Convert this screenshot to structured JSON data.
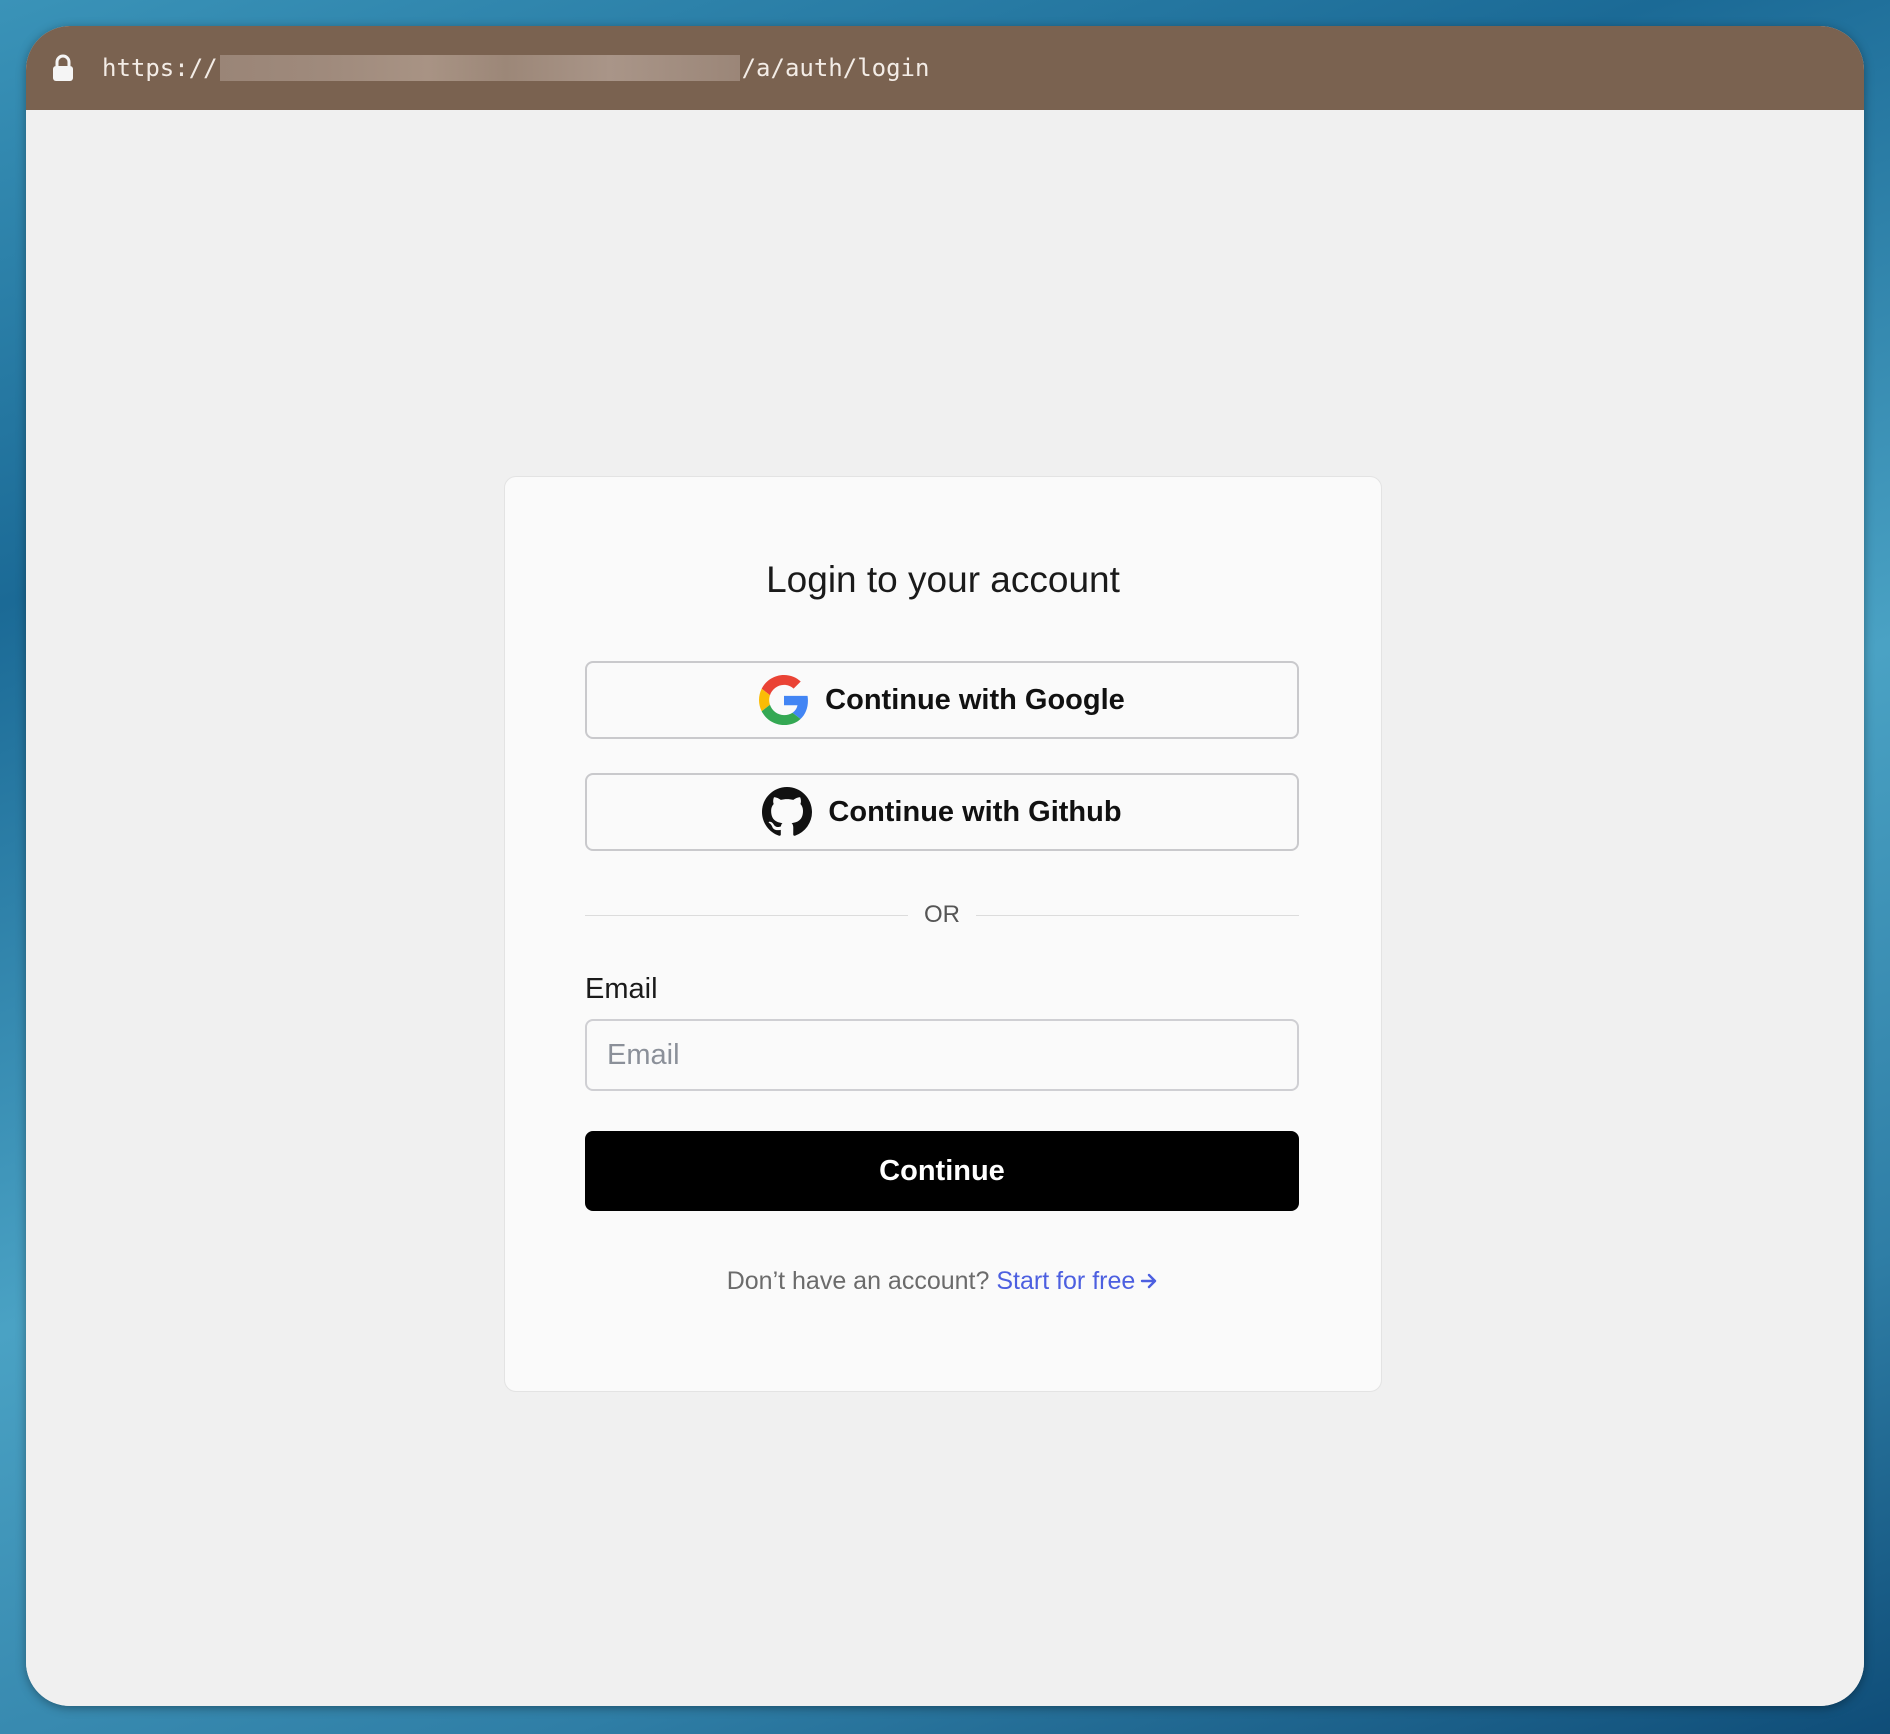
{
  "browser": {
    "url_prefix": "https://",
    "url_suffix": "/a/auth/login",
    "lock_icon": "lock-icon"
  },
  "login": {
    "title": "Login to your account",
    "google_button_label": "Continue with Google",
    "github_button_label": "Continue with Github",
    "divider_text": "OR",
    "email_label": "Email",
    "email_placeholder": "Email",
    "email_value": "",
    "continue_label": "Continue",
    "signup_prompt": "Don’t have an account?",
    "signup_link": "Start for free"
  },
  "colors": {
    "url_bar": "#7a6250",
    "primary_button": "#000000",
    "link": "#4c5fe0",
    "page_background": "#f0f0f0",
    "card_background": "#fafafa"
  },
  "icons": [
    "lock-icon",
    "google-icon",
    "github-icon",
    "arrow-right-icon"
  ]
}
